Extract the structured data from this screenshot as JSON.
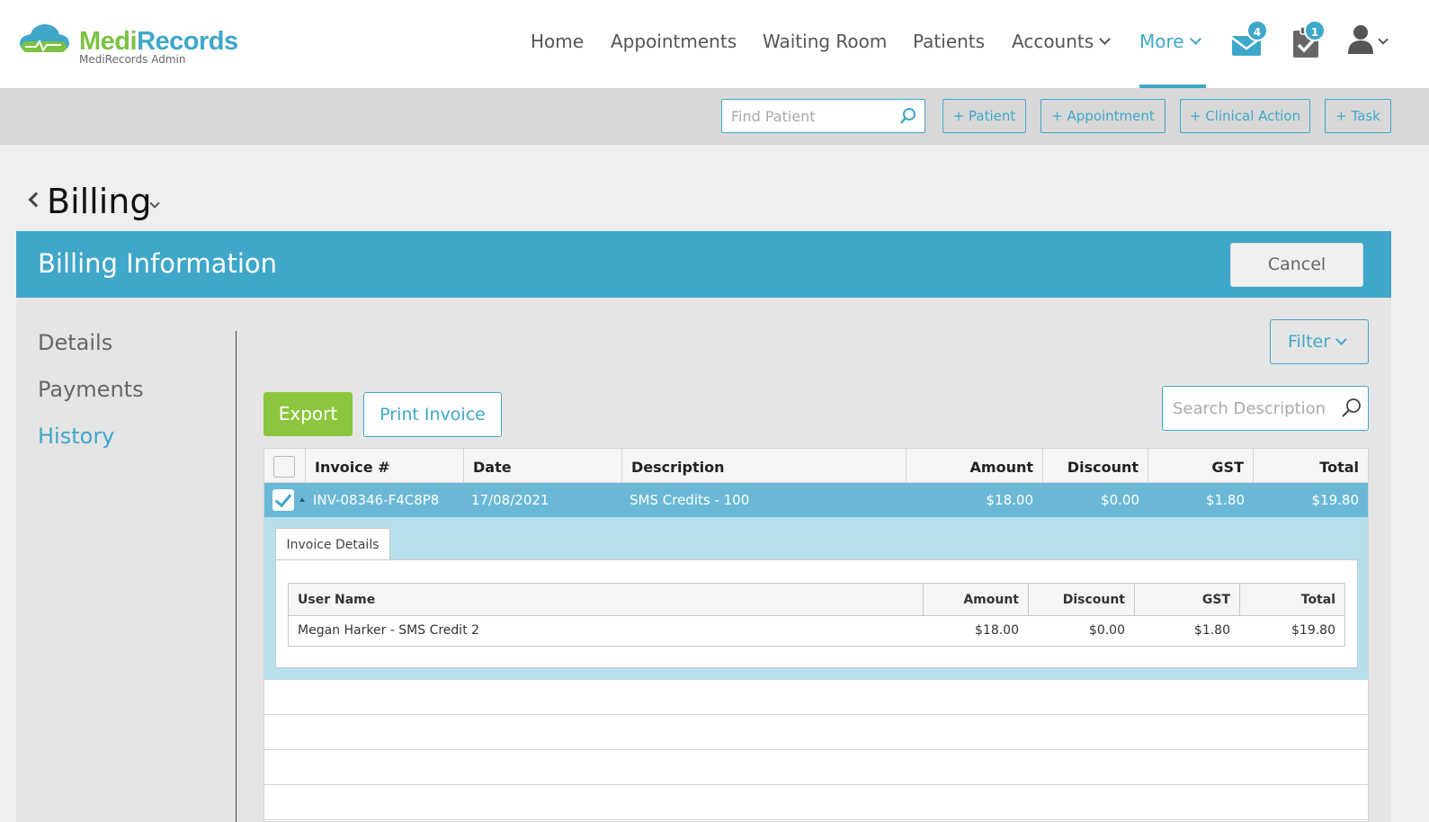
{
  "app": {
    "brand_part1": "Medi",
    "brand_part2": "Records",
    "brand_sub": "MediRecords Admin",
    "colors": {
      "accent": "#3fa7c9",
      "green": "#8cc63f",
      "selected_row": "#6ab8d5",
      "detail_bg": "#b7e0ec"
    }
  },
  "nav": {
    "home": "Home",
    "appointments": "Appointments",
    "waiting_room": "Waiting Room",
    "patients": "Patients",
    "accounts": "Accounts",
    "more": "More",
    "messages_badge": "4",
    "tasks_badge": "1",
    "icons": [
      "mail-icon",
      "clipboard-check-icon",
      "user-icon"
    ]
  },
  "actionbar": {
    "find_placeholder": "Find Patient",
    "add_patient": "+ Patient",
    "add_appointment": "+ Appointment",
    "add_clinical_action": "+ Clinical Action",
    "add_task": "+ Task"
  },
  "page": {
    "title": "Billing",
    "section_title": "Billing Information",
    "cancel": "Cancel"
  },
  "sidebar": {
    "items": [
      {
        "label": "Details"
      },
      {
        "label": "Payments"
      },
      {
        "label": "History"
      }
    ]
  },
  "toolbar": {
    "filter": "Filter",
    "export": "Export",
    "print_invoice": "Print Invoice",
    "search_placeholder": "Search Description"
  },
  "grid": {
    "columns": [
      "Invoice #",
      "Date",
      "Description",
      "Amount",
      "Discount",
      "GST",
      "Total"
    ],
    "rows": [
      {
        "invoice": "INV-08346-F4C8P8",
        "date": "17/08/2021",
        "description": "SMS Credits - 100",
        "amount": "$18.00",
        "discount": "$0.00",
        "gst": "$1.80",
        "total": "$19.80",
        "selected": true
      }
    ],
    "detail": {
      "tab": "Invoice Details",
      "columns": [
        "User Name",
        "Amount",
        "Discount",
        "GST",
        "Total"
      ],
      "rows": [
        {
          "user": "Megan Harker - SMS Credit 2",
          "amount": "$18.00",
          "discount": "$0.00",
          "gst": "$1.80",
          "total": "$19.80"
        }
      ]
    }
  }
}
